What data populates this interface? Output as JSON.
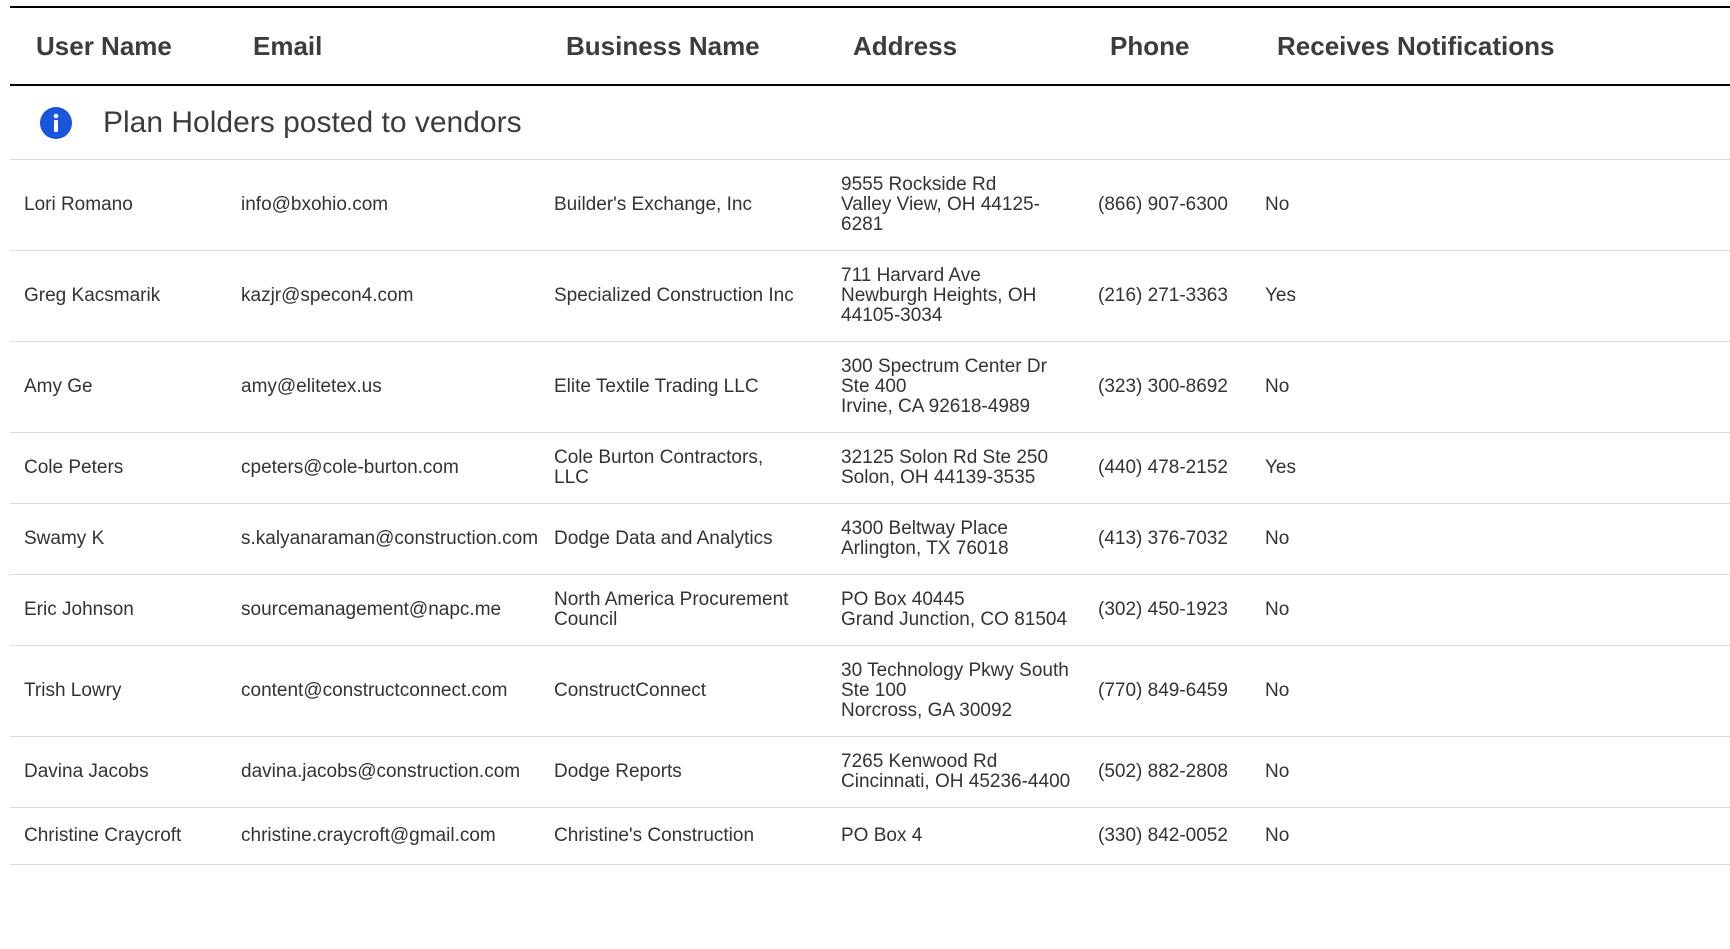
{
  "table": {
    "columns": [
      "User Name",
      "Email",
      "Business Name",
      "Address",
      "Phone",
      "Receives Notifications"
    ]
  },
  "section": {
    "label": "Plan Holders posted to vendors",
    "icon": "info-icon",
    "icon_color": "#1a56db"
  },
  "rows": [
    {
      "user": "Lori Romano",
      "email": "info@bxohio.com",
      "business": "Builder's Exchange, Inc",
      "address": [
        "9555 Rockside Rd",
        "Valley View, OH 44125-",
        "6281"
      ],
      "phone": "(866) 907-6300",
      "notify": "No"
    },
    {
      "user": "Greg Kacsmarik",
      "email": "kazjr@specon4.com",
      "business": "Specialized Construction Inc",
      "address": [
        "711 Harvard Ave",
        "Newburgh Heights, OH",
        "44105-3034"
      ],
      "phone": "(216) 271-3363",
      "notify": "Yes"
    },
    {
      "user": "Amy Ge",
      "email": "amy@elitetex.us",
      "business": "Elite Textile Trading LLC",
      "address": [
        "300 Spectrum Center Dr",
        "Ste 400",
        "Irvine, CA 92618-4989"
      ],
      "phone": "(323) 300-8692",
      "notify": "No"
    },
    {
      "user": "Cole Peters",
      "email": "cpeters@cole-burton.com",
      "business": "Cole Burton Contractors, LLC",
      "address": [
        "32125 Solon Rd Ste 250",
        "Solon, OH 44139-3535"
      ],
      "phone": "(440) 478-2152",
      "notify": "Yes"
    },
    {
      "user": "Swamy K",
      "email": "s.kalyanaraman@construction.com",
      "business": "Dodge Data and Analytics",
      "address": [
        "4300 Beltway Place",
        "Arlington, TX 76018"
      ],
      "phone": "(413) 376-7032",
      "notify": "No"
    },
    {
      "user": "Eric Johnson",
      "email": "sourcemanagement@napc.me",
      "business": "North America Procurement Council",
      "address": [
        "PO Box 40445",
        "Grand Junction, CO 81504"
      ],
      "phone": "(302) 450-1923",
      "notify": "No"
    },
    {
      "user": "Trish Lowry",
      "email": "content@constructconnect.com",
      "business": "ConstructConnect",
      "address": [
        "30 Technology Pkwy South",
        "Ste 100",
        "Norcross, GA 30092"
      ],
      "phone": "(770) 849-6459",
      "notify": "No"
    },
    {
      "user": "Davina Jacobs",
      "email": "davina.jacobs@construction.com",
      "business": "Dodge Reports",
      "address": [
        "7265 Kenwood Rd",
        "Cincinnati, OH 45236-4400"
      ],
      "phone": "(502) 882-2808",
      "notify": "No"
    },
    {
      "user": "Christine Craycroft",
      "email": "christine.craycroft@gmail.com",
      "business": "Christine's Construction",
      "address": [
        "PO Box 4"
      ],
      "phone": "(330) 842-0052",
      "notify": "No"
    }
  ]
}
